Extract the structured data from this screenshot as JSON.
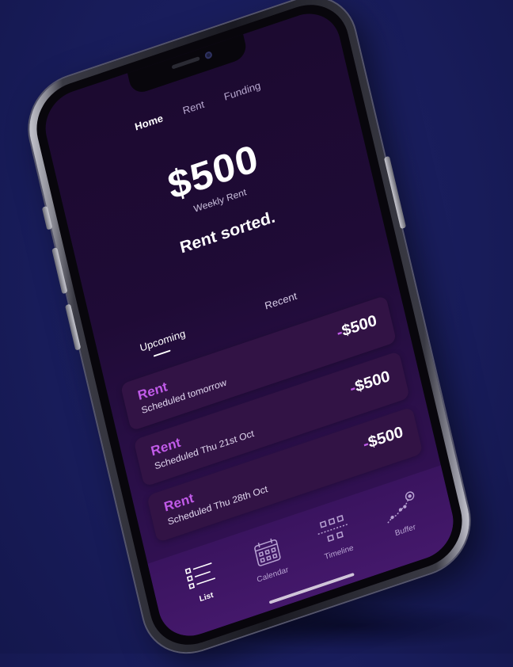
{
  "nav": {
    "home": "Home",
    "rent": "Rent",
    "funding": "Funding"
  },
  "summary": {
    "amount": "$500",
    "amount_caption": "Weekly Rent",
    "headline": "Rent sorted."
  },
  "tabs": {
    "upcoming": "Upcoming",
    "recent": "Recent"
  },
  "payments": [
    {
      "title": "Rent",
      "scheduled": "Scheduled tomorrow",
      "sign": "-",
      "amount": "$500"
    },
    {
      "title": "Rent",
      "scheduled": "Scheduled Thu 21st Oct",
      "sign": "-",
      "amount": "$500"
    },
    {
      "title": "Rent",
      "scheduled": "Scheduled Thu 28th Oct",
      "sign": "-",
      "amount": "$500"
    }
  ],
  "tabbar": {
    "list": "List",
    "calendar": "Calendar",
    "timeline": "Timeline",
    "buffer": "Buffer"
  },
  "colors": {
    "background": "#181c5a",
    "screen": "#1f0b36",
    "accent": "#c05ae8",
    "card": "#321345",
    "tabbar": "#3a145f"
  },
  "icons": [
    "list-icon",
    "calendar-icon",
    "timeline-icon",
    "buffer-icon"
  ]
}
